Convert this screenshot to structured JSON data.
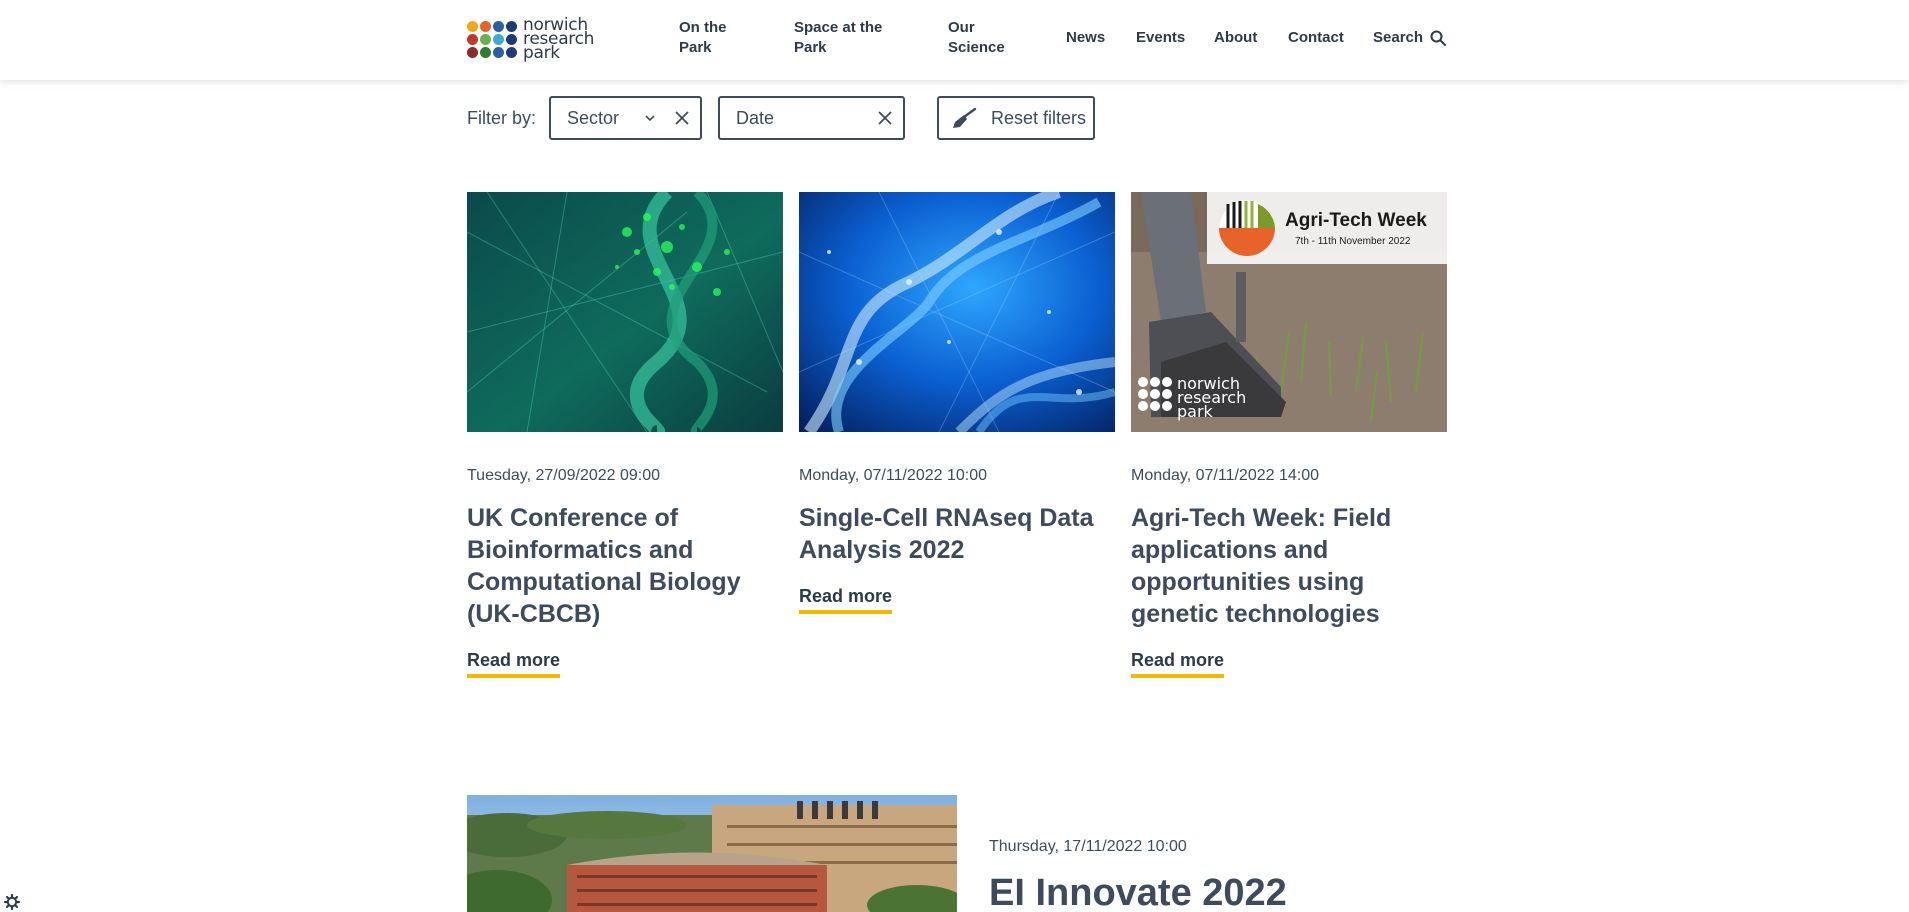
{
  "header": {
    "logo_text": [
      "norwich",
      "research",
      "park"
    ],
    "nav": [
      {
        "label_line1": "On the",
        "label_line2": "Park"
      },
      {
        "label_line1": "Space at the",
        "label_line2": "Park"
      },
      {
        "label_line1": "Our",
        "label_line2": "Science"
      },
      {
        "label": "News"
      },
      {
        "label": "Events"
      },
      {
        "label": "About"
      },
      {
        "label": "Contact"
      }
    ],
    "search_label": "Search"
  },
  "filters": {
    "label": "Filter by:",
    "sector_placeholder": "Sector",
    "date_placeholder": "Date",
    "reset_label": "Reset filters"
  },
  "events": [
    {
      "date": "Tuesday, 27/09/2022 09:00",
      "title": "UK Conference of Bioinformatics and Computational Biology (UK-CBCB)",
      "link": "Read more"
    },
    {
      "date": "Monday, 07/11/2022 10:00",
      "title": "Single-Cell RNAseq Data Analysis 2022",
      "link": "Read more"
    },
    {
      "date": "Monday, 07/11/2022 14:00",
      "title": "Agri-Tech Week: Field applications and opportunities using genetic technologies",
      "link": "Read more",
      "image_text": {
        "banner_title": "Agri-Tech Week",
        "banner_dates": "7th - 11th November 2022",
        "watermark": [
          "norwich",
          "research",
          "park"
        ]
      }
    }
  ],
  "featured_event": {
    "date": "Thursday, 17/11/2022 10:00",
    "title": "EI Innovate 2022"
  },
  "colors": {
    "text": "#3d4b5c",
    "accent_underline": "#f5b800",
    "brand_orange": "#e8632a"
  }
}
